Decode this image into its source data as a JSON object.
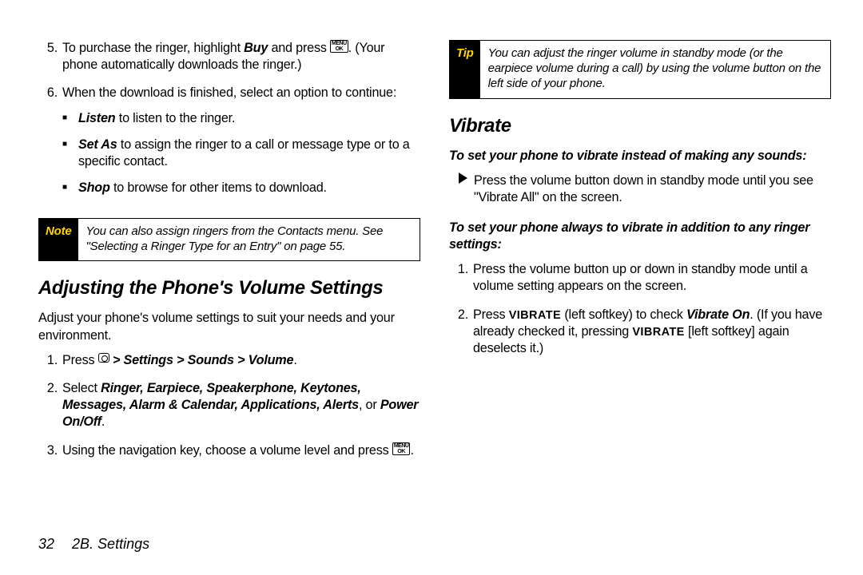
{
  "left": {
    "ol_start": [
      {
        "num": "5.",
        "pre": "To purchase the ringer, highlight ",
        "buy": "Buy",
        "mid": " and press ",
        "post": ". (Your phone automatically downloads the ringer.)"
      },
      {
        "num": "6.",
        "text": "When the download is finished, select an option to continue:"
      }
    ],
    "ul": [
      {
        "lead": "Listen",
        "rest": " to listen to the ringer."
      },
      {
        "lead": "Set As",
        "rest": " to assign the ringer to a call or message type or to a specific contact."
      },
      {
        "lead": "Shop",
        "rest": " to browse for other items to download."
      }
    ],
    "note_tag": "Note",
    "note_text": "You can also assign ringers from the Contacts menu. See \"Selecting a Ringer Type for an Entry\" on page 55.",
    "h3": "Adjusting the Phone's Volume Settings",
    "intro": "Adjust your phone's volume settings to suit your needs and your environment.",
    "ol2": [
      {
        "num": "1.",
        "pre": "Press ",
        "path": " > Settings > Sounds > Volume",
        "post": "."
      },
      {
        "num": "2.",
        "pre": "Select ",
        "boldlist": "Ringer, Earpiece, Speakerphone, Keytones, Messages, Alarm & Calendar, Applications, Alerts",
        "mid": ", or ",
        "last": "Power On/Off",
        "post": "."
      },
      {
        "num": "3.",
        "pre": "Using the navigation key, choose a volume level and press ",
        "post": "."
      }
    ]
  },
  "right": {
    "tip_tag": "Tip",
    "tip_text": "You can adjust the ringer volume in standby mode (or the earpiece volume during a call) by using the volume button on the left side of your phone.",
    "h3": "Vibrate",
    "lead1": "To set your phone to vibrate instead of making any sounds:",
    "bullet1": "Press the volume button down in standby mode until you see \"Vibrate All\" on the screen.",
    "lead2": "To set your phone always to vibrate in addition to any ringer settings:",
    "ol": [
      {
        "num": "1.",
        "text": "Press the volume button up or down in standby mode until a volume setting appears on the screen."
      },
      {
        "num": "2.",
        "pre": "Press ",
        "btn1": "VIBRATE",
        "mid1": " (left softkey) to check ",
        "vo": "Vibrate On",
        "mid2": ". (If you have already checked it, pressing ",
        "btn2": "VIBRATE",
        "post": " [left softkey] again deselects it.)"
      }
    ]
  },
  "footer": {
    "pagenum": "32",
    "section": "2B. Settings"
  }
}
